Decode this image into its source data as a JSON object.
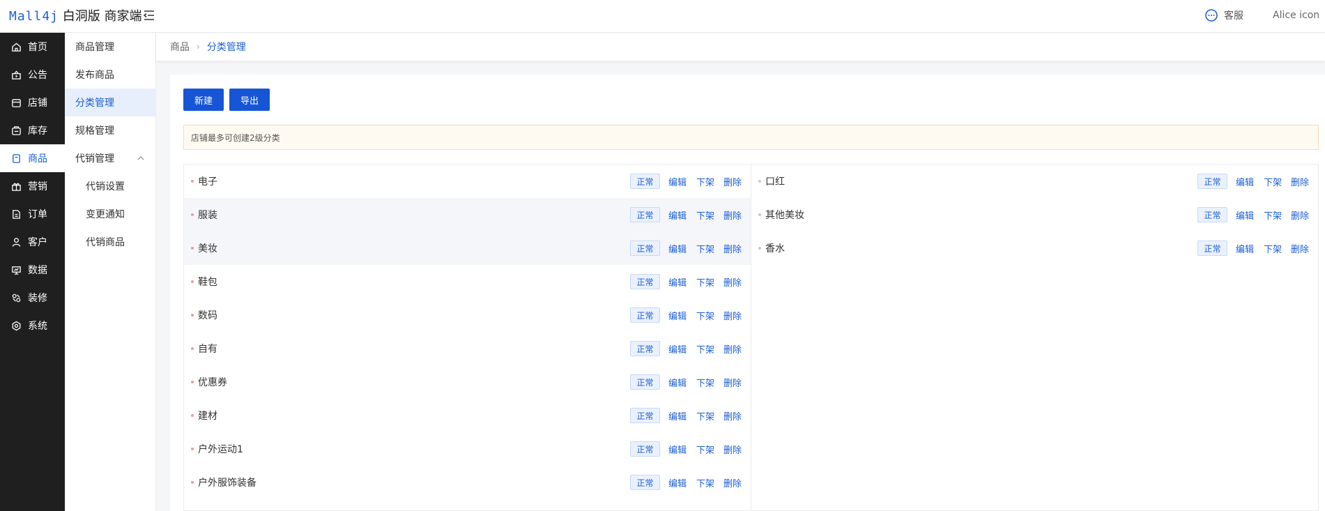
{
  "header": {
    "logo_brand": "Mall4j",
    "logo_text": "白洞版 商家端",
    "service_label": "客服",
    "user_label": "Alice icon"
  },
  "nav": {
    "items": [
      {
        "label": "首页",
        "icon": "home-icon"
      },
      {
        "label": "公告",
        "icon": "notice-icon"
      },
      {
        "label": "店铺",
        "icon": "store-icon"
      },
      {
        "label": "库存",
        "icon": "inventory-icon"
      },
      {
        "label": "商品",
        "icon": "product-icon"
      },
      {
        "label": "营销",
        "icon": "gift-icon"
      },
      {
        "label": "订单",
        "icon": "order-icon"
      },
      {
        "label": "客户",
        "icon": "user-icon"
      },
      {
        "label": "数据",
        "icon": "data-icon"
      },
      {
        "label": "装修",
        "icon": "decorate-icon"
      },
      {
        "label": "系统",
        "icon": "settings-icon"
      }
    ],
    "active_index": 4
  },
  "subnav": {
    "items": [
      {
        "label": "商品管理"
      },
      {
        "label": "发布商品"
      },
      {
        "label": "分类管理"
      },
      {
        "label": "规格管理"
      },
      {
        "label": "代销管理"
      },
      {
        "label": "代销设置"
      },
      {
        "label": "变更通知"
      },
      {
        "label": "代销商品"
      }
    ]
  },
  "breadcrumb": {
    "parent": "商品",
    "current": "分类管理"
  },
  "toolbar": {
    "new_label": "新建",
    "export_label": "导出"
  },
  "notice_text": "店铺最多可创建2级分类",
  "ops": {
    "status": "正常",
    "edit": "编辑",
    "off": "下架",
    "delete": "删除"
  },
  "categories_left": [
    "电子",
    "服装",
    "美妆",
    "鞋包",
    "数码",
    "自有",
    "优惠券",
    "建材",
    "户外运动1",
    "户外服饰装备"
  ],
  "categories_right": [
    "口红",
    "其他美妆",
    "香水"
  ],
  "colors": {
    "accent": "#1b5fd6",
    "nav_bg": "#1f1f1f",
    "notice_bg": "#fffaf1"
  }
}
